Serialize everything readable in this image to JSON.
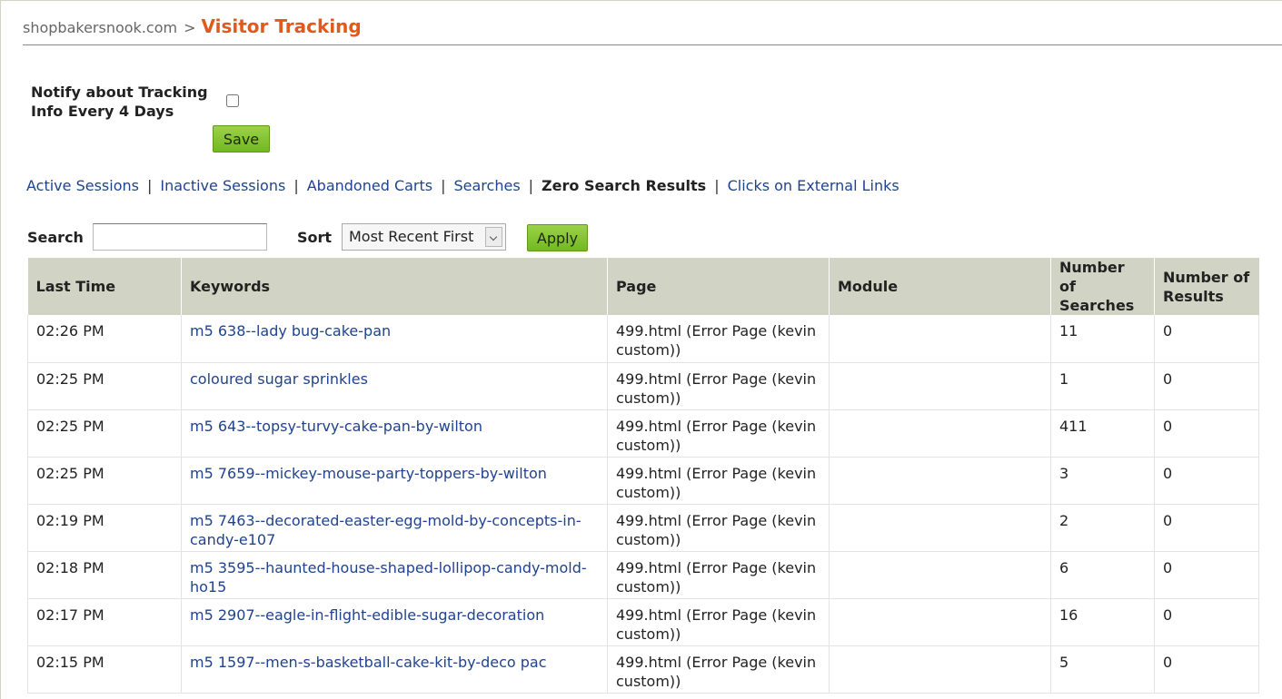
{
  "breadcrumb": {
    "site": "shopbakersnook.com",
    "separator": ">",
    "title": "Visitor Tracking"
  },
  "notify": {
    "label": "Notify about Tracking Info Every 4 Days",
    "checked": false,
    "save_label": "Save"
  },
  "tabs": [
    {
      "label": "Active Sessions",
      "active": false
    },
    {
      "label": "Inactive Sessions",
      "active": false
    },
    {
      "label": "Abandoned Carts",
      "active": false
    },
    {
      "label": "Searches",
      "active": false
    },
    {
      "label": "Zero Search Results",
      "active": true
    },
    {
      "label": "Clicks on External Links",
      "active": false
    }
  ],
  "tab_separator": "|",
  "filters": {
    "search_label": "Search",
    "search_value": "",
    "sort_label": "Sort",
    "sort_value": "Most Recent First",
    "apply_label": "Apply"
  },
  "table": {
    "headers": [
      "Last Time",
      "Keywords",
      "Page",
      "Module",
      "Number of Searches",
      "Number of Results"
    ],
    "rows": [
      {
        "time": "02:26 PM",
        "keywords": "m5 638--lady bug-cake-pan",
        "page": "499.html (Error Page (kevin custom))",
        "module": "",
        "searches": "11",
        "results": "0"
      },
      {
        "time": "02:25 PM",
        "keywords": "coloured sugar sprinkles",
        "page": "499.html (Error Page (kevin custom))",
        "module": "",
        "searches": "1",
        "results": "0"
      },
      {
        "time": "02:25 PM",
        "keywords": "m5 643--topsy-turvy-cake-pan-by-wilton",
        "page": "499.html (Error Page (kevin custom))",
        "module": "",
        "searches": "411",
        "results": "0"
      },
      {
        "time": "02:25 PM",
        "keywords": "m5 7659--mickey-mouse-party-toppers-by-wilton",
        "page": "499.html (Error Page (kevin custom))",
        "module": "",
        "searches": "3",
        "results": "0"
      },
      {
        "time": "02:19 PM",
        "keywords": "m5 7463--decorated-easter-egg-mold-by-concepts-in-candy-e107",
        "page": "499.html (Error Page (kevin custom))",
        "module": "",
        "searches": "2",
        "results": "0"
      },
      {
        "time": "02:18 PM",
        "keywords": "m5 3595--haunted-house-shaped-lollipop-candy-mold-ho15",
        "page": "499.html (Error Page (kevin custom))",
        "module": "",
        "searches": "6",
        "results": "0"
      },
      {
        "time": "02:17 PM",
        "keywords": "m5 2907--eagle-in-flight-edible-sugar-decoration",
        "page": "499.html (Error Page (kevin custom))",
        "module": "",
        "searches": "16",
        "results": "0"
      },
      {
        "time": "02:15 PM",
        "keywords": "m5 1597--men-s-basketball-cake-kit-by-deco pac",
        "page": "499.html (Error Page (kevin custom))",
        "module": "",
        "searches": "5",
        "results": "0"
      }
    ]
  }
}
